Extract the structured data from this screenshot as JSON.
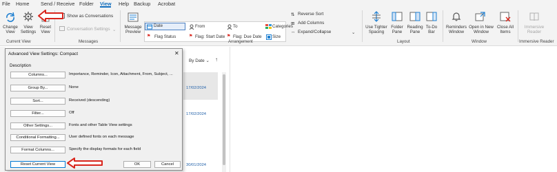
{
  "menu": {
    "items": [
      "File",
      "Home",
      "Send / Receive",
      "Folder",
      "View",
      "Help",
      "Backup",
      "Acrobat"
    ],
    "active": "View"
  },
  "ribbon": {
    "current_view": {
      "change_view": "Change View",
      "view_settings": "View Settings",
      "reset_view": "Reset View",
      "label": "Current View"
    },
    "messages": {
      "show_as_conversations": "Show as Conversations",
      "conversation_settings": "Conversation Settings",
      "label": "Messages"
    },
    "arrangement": {
      "message_preview": "Message Preview",
      "gallery": [
        "Date",
        "From",
        "To",
        "Categories",
        "Flag Status",
        "Flag: Start Date",
        "Flag: Due Date",
        "Size"
      ],
      "reverse_sort": "Reverse Sort",
      "add_columns": "Add Columns",
      "expand_collapse": "Expand/Collapse",
      "label": "Arrangement"
    },
    "layout": {
      "use_tighter_spacing": "Use Tighter Spacing",
      "folder_pane": "Folder Pane",
      "reading_pane": "Reading Pane",
      "todo_bar": "To-Do Bar",
      "label": "Layout"
    },
    "window": {
      "reminders_window": "Reminders Window",
      "open_new_window": "Open in New Window",
      "close_all_items": "Close All Items",
      "label": "Window"
    },
    "immersive": {
      "immersive_reader": "Immersive Reader",
      "label": "Immersive Reader"
    }
  },
  "maillist": {
    "sort": "By Date",
    "dates": [
      "17/02/2024",
      "17/02/2024",
      "30/01/2024"
    ]
  },
  "dialog": {
    "title": "Advanced View Settings: Compact",
    "close": "✕",
    "description": "Description",
    "rows": [
      {
        "button": "Columns...",
        "value": "Importance, Reminder, Icon, Attachment, From, Subject, ..."
      },
      {
        "button": "Group By...",
        "value": "None"
      },
      {
        "button": "Sort...",
        "value": "Received (descending)"
      },
      {
        "button": "Filter...",
        "value": "Off"
      },
      {
        "button": "Other Settings...",
        "value": "Fonts and other Table View settings"
      },
      {
        "button": "Conditional Formatting...",
        "value": "User defined fonts on each message"
      },
      {
        "button": "Format Columns...",
        "value": "Specify the display formats for each field"
      }
    ],
    "reset_current_view": "Reset Current View",
    "ok": "OK",
    "cancel": "Cancel"
  },
  "colors": {
    "accent": "#0f6cbd",
    "arrow": "#d9251c",
    "ribbon_bg": "#f3f3f3",
    "dialog_bg": "#f0f0f0"
  }
}
